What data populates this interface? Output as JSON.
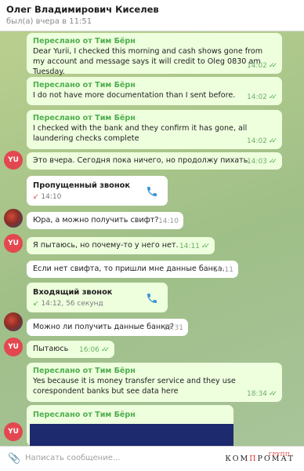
{
  "header": {
    "name": "Олег Владимирович Киселев",
    "status": "был(а) вчера в 11:51"
  },
  "messages": [
    {
      "forward": "Переслано от Тим Бёрн",
      "text": "Dear Yurii, I checked this morning and cash shows gone from my account and message says it will credit to Oleg 0830 am Tuesday.",
      "time": "14:02"
    },
    {
      "forward": "Переслано от Тим Бёрн",
      "text": "I do not have more documentation than I sent before.",
      "time": "14:02"
    },
    {
      "forward": "Переслано от Тим Бёрн",
      "text": "I checked with the bank and they confirm it has gone, all laundering checks complete",
      "time": "14:02"
    },
    {
      "text": "Это вчера. Сегодня пока ничего, но продолжу пихать.",
      "time": "14:03"
    },
    {
      "title": "Пропущенный звонок",
      "arrow": "↙",
      "time": "14:10"
    },
    {
      "text": "Юра, а можно получить свифт?",
      "time": "14:10"
    },
    {
      "text": "Я пытаюсь, но почему-то у него нет.",
      "time": "14:11"
    },
    {
      "text": "Если нет свифта, то пришли мне данные банка.",
      "time": "14:11"
    },
    {
      "title": "Входящий звонок",
      "arrow": "↙",
      "time": "14:12, 56 секунд"
    },
    {
      "text": "Можно ли получить данные банка?",
      "time": "15:31"
    },
    {
      "text": "Пытаюсь",
      "time": "16:06"
    },
    {
      "forward": "Переслано от Тим Бёрн",
      "text": "Yes because it is money transfer service and they use corespondent banks but see data here",
      "time": "18:34"
    },
    {
      "forward": "Переслано от Тим Бёрн"
    }
  ],
  "avatars": {
    "yu": "YU"
  },
  "input": {
    "placeholder": "Написать сообщение..."
  },
  "watermark": {
    "word_black_1": "КОМ",
    "word_red": "П",
    "word_black_2": "РОМАТ",
    "small": "ГРУПП"
  },
  "colors": {
    "outgoing": "#eeffde",
    "incoming": "#ffffff",
    "forward_label": "#4fae4e",
    "avatar_yu": "#e3474f"
  },
  "icons": [
    "attach-icon",
    "phone-icon",
    "double-check-icon",
    "missed-call-arrow-icon",
    "incoming-call-arrow-icon"
  ]
}
